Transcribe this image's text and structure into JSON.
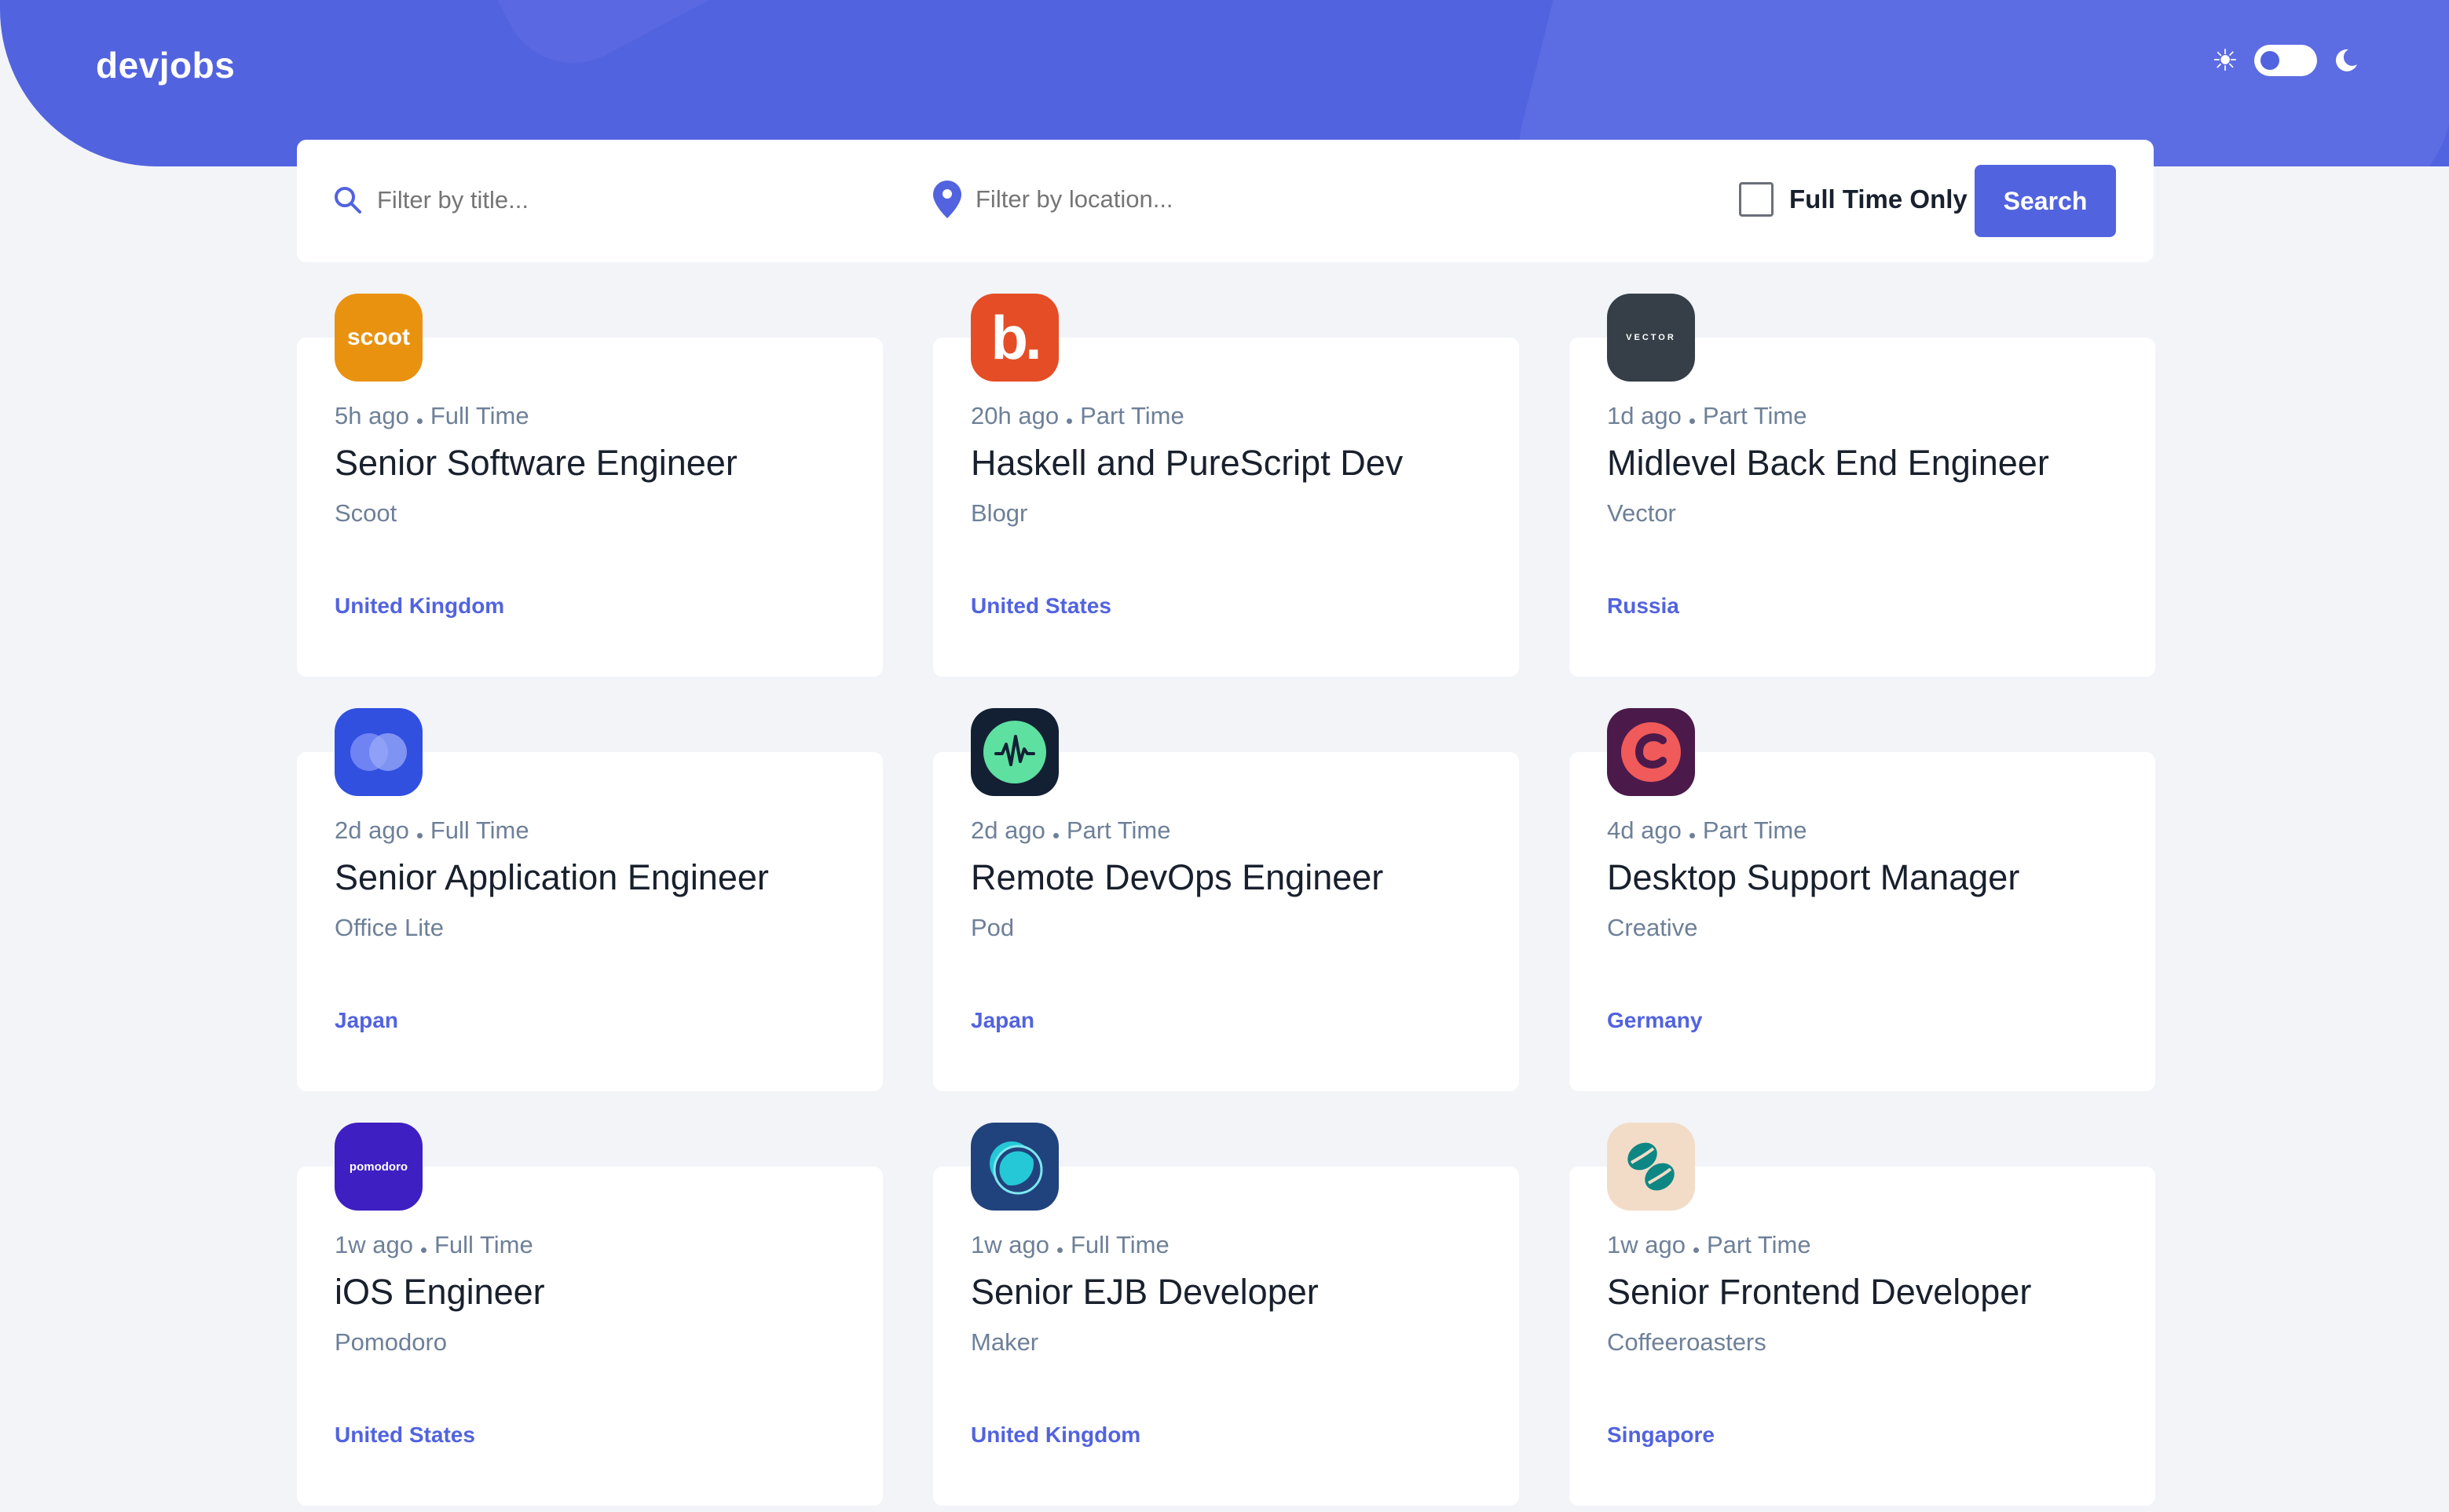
{
  "app": {
    "logo": "devjobs"
  },
  "theme": {
    "light_icon": "sun-icon",
    "dark_icon": "moon-icon",
    "mode": "light"
  },
  "filters": {
    "title_placeholder": "Filter by title...",
    "location_placeholder": "Filter by location...",
    "full_time_label": "Full Time Only",
    "full_time_checked": false,
    "search_label": "Search"
  },
  "colors": {
    "accent": "#5263df",
    "background": "#f2f4f8",
    "text": "#19202d",
    "muted": "#6e8098"
  },
  "jobs": [
    {
      "posted": "5h ago",
      "contract": "Full Time",
      "position": "Senior Software Engineer",
      "company": "Scoot",
      "location": "United Kingdom",
      "logo_text": "scoot",
      "logo_color": "#e99210"
    },
    {
      "posted": "20h ago",
      "contract": "Part Time",
      "position": "Haskell and PureScript Dev",
      "company": "Blogr",
      "location": "United States",
      "logo_text": "b.",
      "logo_color": "#e54d26"
    },
    {
      "posted": "1d ago",
      "contract": "Part Time",
      "position": "Midlevel Back End Engineer",
      "company": "Vector",
      "location": "Russia",
      "logo_text": "VECTOR",
      "logo_color": "#363f47"
    },
    {
      "posted": "2d ago",
      "contract": "Full Time",
      "position": "Senior Application Engineer",
      "company": "Office Lite",
      "location": "Japan",
      "logo_text": "",
      "logo_color": "#4e2fd8"
    },
    {
      "posted": "2d ago",
      "contract": "Part Time",
      "position": "Remote DevOps Engineer",
      "company": "Pod",
      "location": "Japan",
      "logo_text": "",
      "logo_color": "#132034"
    },
    {
      "posted": "4d ago",
      "contract": "Part Time",
      "position": "Desktop Support Manager",
      "company": "Creative",
      "location": "Germany",
      "logo_text": "",
      "logo_color": "#4b1a4a"
    },
    {
      "posted": "1w ago",
      "contract": "Full Time",
      "position": "iOS Engineer",
      "company": "Pomodoro",
      "location": "United States",
      "logo_text": "pomodoro",
      "logo_color": "#3e1fc2"
    },
    {
      "posted": "1w ago",
      "contract": "Full Time",
      "position": "Senior EJB Developer",
      "company": "Maker",
      "location": "United Kingdom",
      "logo_text": "",
      "logo_color": "#21437d"
    },
    {
      "posted": "1w ago",
      "contract": "Part Time",
      "position": "Senior Frontend Developer",
      "company": "Coffeeroasters",
      "location": "Singapore",
      "logo_text": "",
      "logo_color": "#f3dcc7"
    }
  ]
}
